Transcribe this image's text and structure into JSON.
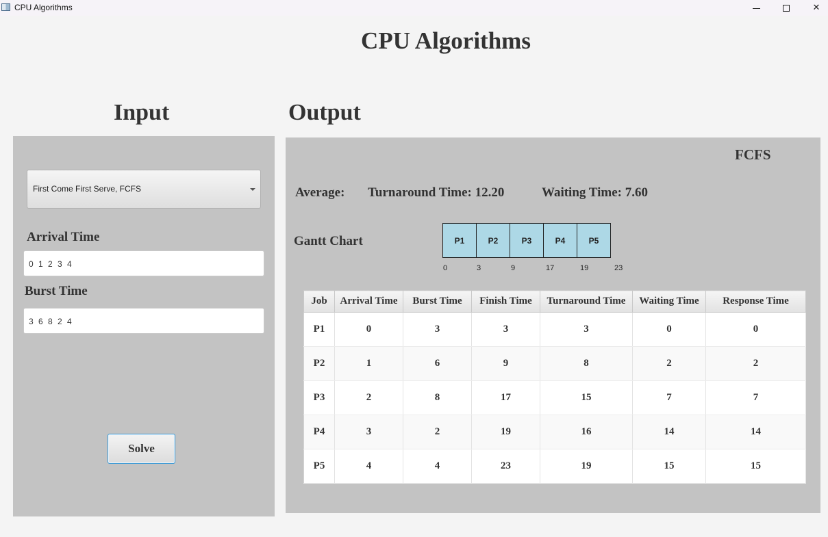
{
  "window": {
    "title": "CPU Algorithms",
    "icon": "app-window-icon",
    "controls": {
      "minimize": "minimize-icon",
      "maximize": "maximize-icon",
      "close": "✕"
    }
  },
  "app_title": "CPU Algorithms",
  "input": {
    "heading": "Input",
    "algorithm_select": {
      "value": "First Come First Serve, FCFS"
    },
    "arrival_label": "Arrival Time",
    "arrival_value": "0 1 2 3 4",
    "burst_label": "Burst Time",
    "burst_value": "3 6 8 2 4",
    "solve_label": "Solve"
  },
  "output": {
    "heading": "Output",
    "algorithm_name": "FCFS",
    "average_label": "Average:",
    "turnaround_text": "Turnaround Time: 12.20",
    "waiting_text": "Waiting Time: 7.60",
    "gantt_label": "Gantt Chart",
    "gantt": {
      "blocks": [
        "P1",
        "P2",
        "P3",
        "P4",
        "P5"
      ],
      "ticks": [
        "0",
        "3",
        "9",
        "17",
        "19",
        "23"
      ],
      "block_color": "#add8e6"
    },
    "table": {
      "headers": [
        "Job",
        "Arrival Time",
        "Burst Time",
        "Finish Time",
        "Turnaround Time",
        "Waiting Time",
        "Response Time"
      ],
      "rows": [
        [
          "P1",
          "0",
          "3",
          "3",
          "3",
          "0",
          "0"
        ],
        [
          "P2",
          "1",
          "6",
          "9",
          "8",
          "2",
          "2"
        ],
        [
          "P3",
          "2",
          "8",
          "17",
          "15",
          "7",
          "7"
        ],
        [
          "P4",
          "3",
          "2",
          "19",
          "16",
          "14",
          "14"
        ],
        [
          "P5",
          "4",
          "4",
          "23",
          "19",
          "15",
          "15"
        ]
      ]
    }
  },
  "colors": {
    "panel": "#c3c3c3",
    "background": "#f4f4f4",
    "focus_accent": "#3e9bd6"
  }
}
